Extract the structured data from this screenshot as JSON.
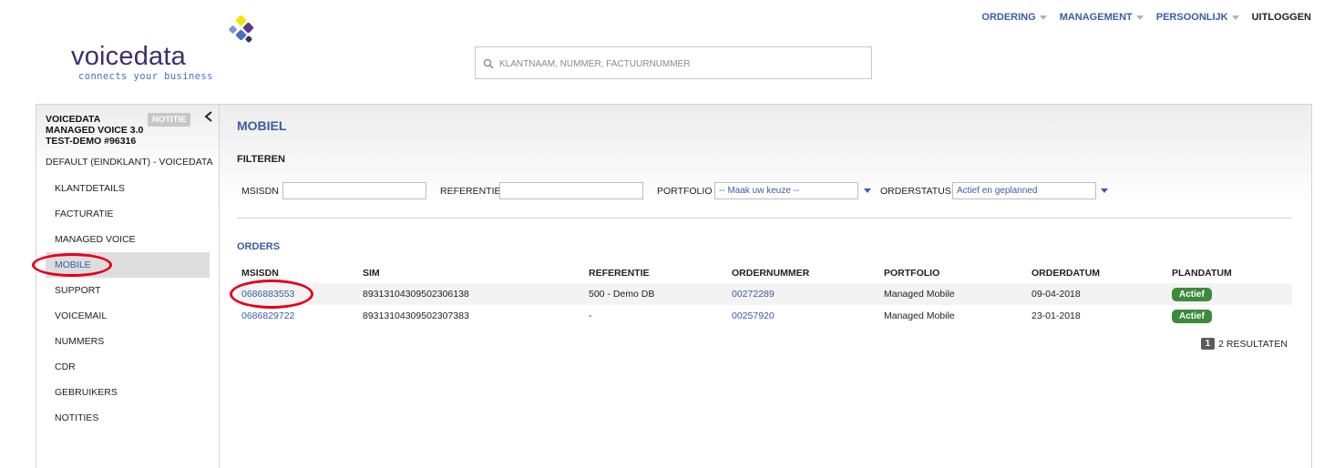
{
  "brand": {
    "name": "voicedata",
    "tagline": "connects your business",
    "colors": {
      "primary": "#3a2f6e",
      "link": "#3a5ca8",
      "accent_yellow": "#f2e600",
      "accent_purple": "#5a3a8a",
      "accent_blue": "#4b6fbf"
    }
  },
  "search": {
    "placeholder": "KLANTNAAM, NUMMER, FACTUURNUMMER",
    "icon": "search-icon"
  },
  "topnav": [
    {
      "label": "ORDERING",
      "has_dropdown": true
    },
    {
      "label": "MANAGEMENT",
      "has_dropdown": true
    },
    {
      "label": "PERSOONLIJK",
      "has_dropdown": true
    },
    {
      "label": "UITLOGGEN",
      "has_dropdown": false
    }
  ],
  "sidebar": {
    "header_lines": [
      "VOICEDATA",
      "MANAGED VOICE 3.0",
      "TEST-DEMO #96316"
    ],
    "badge": "NOTITIE",
    "default_line": "DEFAULT (EINDKLANT) - VOICEDATA",
    "items": [
      {
        "label": "KLANTDETAILS"
      },
      {
        "label": "FACTURATIE"
      },
      {
        "label": "MANAGED VOICE"
      },
      {
        "label": "MOBILE",
        "active": true
      },
      {
        "label": "SUPPORT"
      },
      {
        "label": "VOICEMAIL"
      },
      {
        "label": "NUMMERS"
      },
      {
        "label": "CDR"
      },
      {
        "label": "GEBRUIKERS"
      },
      {
        "label": "NOTITIES"
      }
    ]
  },
  "main": {
    "title": "MOBIEL",
    "filter": {
      "title": "FILTEREN",
      "msisdn_label": "MSISDN",
      "referentie_label": "REFERENTIE",
      "portfolio_label": "PORTFOLIO",
      "portfolio_value": "-- Maak uw keuze --",
      "orderstatus_label": "ORDERSTATUS",
      "orderstatus_value": "Actief en geplanned"
    },
    "orders": {
      "title": "ORDERS",
      "columns": [
        "MSISDN",
        "SIM",
        "REFERENTIE",
        "ORDERNUMMER",
        "PORTFOLIO",
        "ORDERDATUM",
        "PLANDATUM"
      ],
      "rows": [
        {
          "msisdn": "0686883553",
          "sim": "89313104309502306138",
          "referentie": "500 - Demo DB",
          "ordernummer": "00272289",
          "portfolio": "Managed Mobile",
          "orderdatum": "09-04-2018",
          "status": "Actief"
        },
        {
          "msisdn": "0686829722",
          "sim": "89313104309502307383",
          "referentie": "-",
          "ordernummer": "00257920",
          "portfolio": "Managed Mobile",
          "orderdatum": "23-01-2018",
          "status": "Actief"
        }
      ],
      "pager": {
        "page": "1",
        "results": "2 RESULTATEN"
      }
    }
  }
}
